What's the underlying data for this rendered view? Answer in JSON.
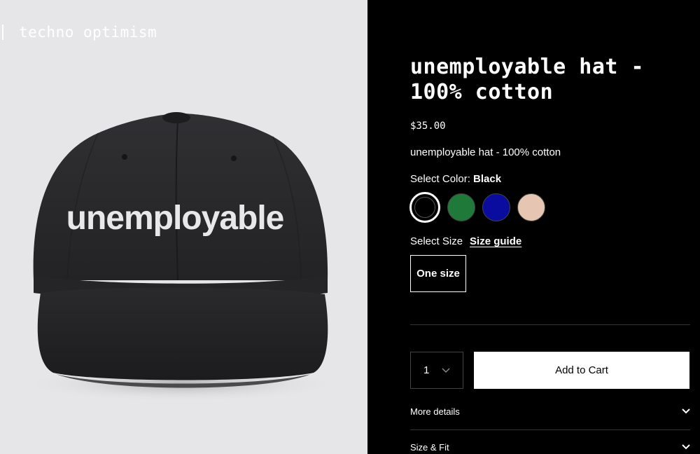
{
  "brand": {
    "name": "techno optimism"
  },
  "hat_image": {
    "embroidery": "unemployable",
    "cap_color": "#2a2a2c"
  },
  "product": {
    "title": "unemployable hat - 100% cotton",
    "price": "$35.00",
    "description": "unemployable hat - 100% cotton"
  },
  "color": {
    "label": "Select Color:",
    "selected": "Black",
    "options": [
      {
        "name": "Black",
        "hex": "#000000",
        "selected": true
      },
      {
        "name": "Green",
        "hex": "#1f7a3a",
        "selected": false
      },
      {
        "name": "Blue",
        "hex": "#0a0ca0",
        "selected": false
      },
      {
        "name": "Beige",
        "hex": "#e6c6b2",
        "selected": false
      }
    ]
  },
  "size": {
    "label": "Select Size",
    "guide_label": "Size guide",
    "options": [
      "One size"
    ]
  },
  "quantity": {
    "value": "1"
  },
  "cart": {
    "add_label": "Add to Cart"
  },
  "accordions": [
    {
      "label": "More details"
    },
    {
      "label": "Size & Fit"
    }
  ]
}
